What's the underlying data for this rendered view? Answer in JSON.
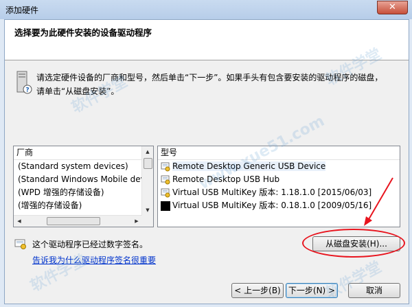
{
  "window": {
    "title": "添加硬件",
    "close_glyph": "✕"
  },
  "header": {
    "title": "选择要为此硬件安装的设备驱动程序"
  },
  "instructions": {
    "line1": "请选定硬件设备的厂商和型号，然后单击“下一步”。如果手头有包含要安装的驱动程序的磁盘，",
    "line2": "请单击“从磁盘安装”。"
  },
  "manufacturer_list": {
    "header": "厂商",
    "items": [
      "(Standard system devices)",
      "(Standard Windows Mobile dev",
      "(WPD 增强的存储设备)",
      "(增强的存储设备)"
    ],
    "scroll_glyphs": {
      "up": "▲",
      "down": "▼",
      "left": "◀",
      "right": "▶",
      "grip": "III"
    }
  },
  "model_list": {
    "header": "型号",
    "items": [
      {
        "label": "Remote Desktop Generic USB Device",
        "icon": "driver-cert-icon",
        "selected": true
      },
      {
        "label": "Remote Desktop USB Hub",
        "icon": "driver-cert-icon",
        "selected": false
      },
      {
        "label": "Virtual USB MultiKey 版本: 1.18.1.0 [2015/06/03]",
        "icon": "driver-cert-icon",
        "selected": false
      },
      {
        "label": "Virtual USB MultiKey 版本: 0.18.1.0 [2009/05/16]",
        "icon": "unsigned-driver-icon",
        "selected": false
      }
    ]
  },
  "signing": {
    "status": "这个驱动程序已经过数字签名。",
    "link": "告诉我为什么驱动程序签名很重要"
  },
  "buttons": {
    "have_disk": "从磁盘安装(H)...",
    "back": "< 上一步(B)",
    "next": "下一步(N) >",
    "cancel": "取消"
  },
  "watermark": {
    "text1": "软件学堂",
    "text2": "www.xue51.com"
  },
  "colors": {
    "annotation_red": "#e8141e",
    "link_blue": "#0033cc"
  }
}
